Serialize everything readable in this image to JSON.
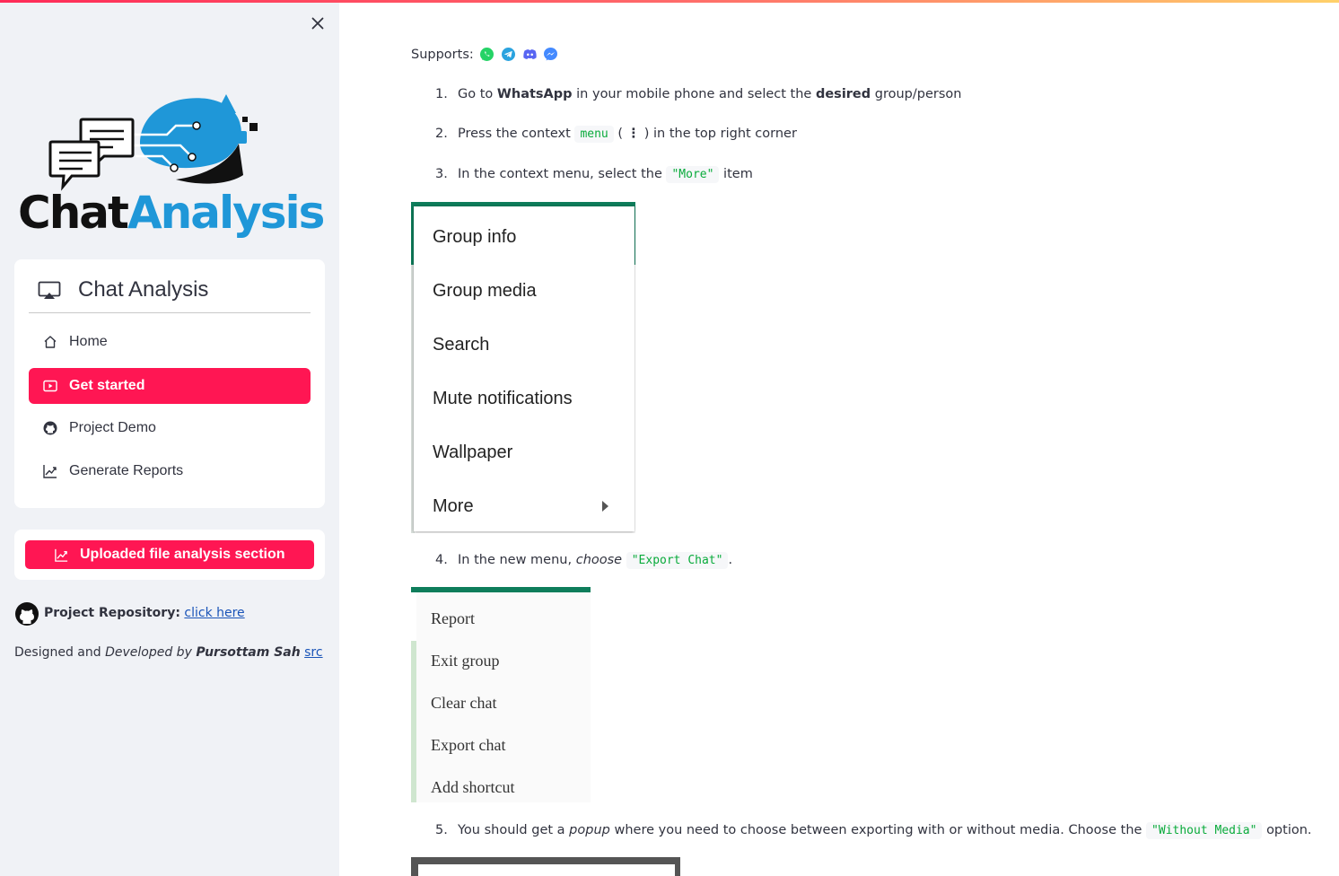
{
  "sidebar": {
    "close_label": "Close sidebar",
    "logo": {
      "part1": "Chat",
      "part2": "Analysis"
    },
    "menu": {
      "title": "Chat Analysis",
      "items": [
        {
          "label": "Home",
          "icon": "house-icon",
          "active": false
        },
        {
          "label": "Get started",
          "icon": "play-btn-icon",
          "active": true
        },
        {
          "label": "Project Demo",
          "icon": "github-icon",
          "active": false
        },
        {
          "label": "Generate Reports",
          "icon": "graph-up-icon",
          "active": false
        }
      ]
    },
    "upload_button": "Uploaded file analysis section",
    "repo": {
      "label": "Project Repository:",
      "link": "click here"
    },
    "credit": {
      "prefix": "Designed and",
      "developed": "Developed by",
      "author": "Pursottam Sah",
      "link": "src"
    }
  },
  "main": {
    "supports_label": "Supports:",
    "platform_icons": [
      "whatsapp-icon",
      "telegram-icon",
      "discord-icon",
      "messenger-icon"
    ],
    "steps": [
      {
        "num": "1.",
        "t1": "Go to ",
        "b1": "WhatsApp",
        "t2": " in your mobile phone and select the ",
        "b2": "desired",
        "t3": " group/person"
      },
      {
        "num": "2.",
        "t1": "Press the context ",
        "code": "menu",
        "t2": " ( ",
        "glyph": "⋮",
        "t3": " ) in the top right corner"
      },
      {
        "num": "3.",
        "t1": "In the context menu, select the ",
        "code": "\"More\"",
        "t2": " item"
      },
      {
        "num": "4.",
        "t1": "In the new menu, ",
        "em": "choose",
        "code": "\"Export Chat\"",
        "t2": "."
      },
      {
        "num": "5.",
        "t1": "You should get a ",
        "em": "popup",
        "t2": " where you need to choose between exporting with or without media. Choose the ",
        "code": "\"Without Media\"",
        "t3": " option."
      }
    ],
    "screenshot1_options": [
      "Group info",
      "Group media",
      "Search",
      "Mute notifications",
      "Wallpaper",
      "More"
    ],
    "screenshot2_options": [
      "Report",
      "Exit group",
      "Clear chat",
      "Export chat",
      "Add shortcut"
    ]
  },
  "colors": {
    "accent": "#ff1653",
    "code_green": "#09ab3b",
    "sidebar_bg": "#f0f2f6",
    "logo_blue": "#1f97d8",
    "whatsapp_green": "#25d366"
  }
}
